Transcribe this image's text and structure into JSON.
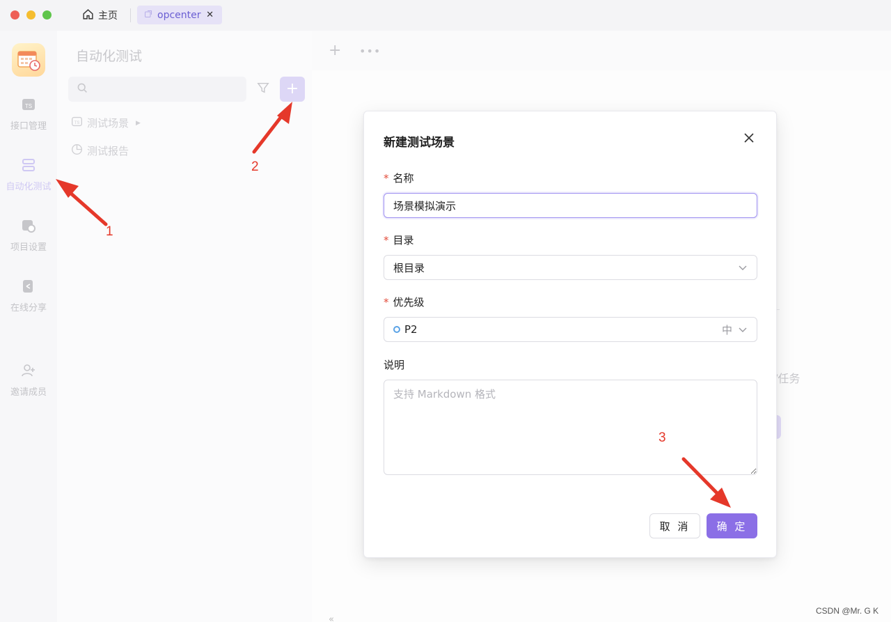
{
  "window": {
    "tabs": [
      {
        "label": "主页",
        "icon": "home-icon"
      },
      {
        "label": "opcenter",
        "icon": "external-link-icon",
        "active": true
      }
    ]
  },
  "leftnav": {
    "items": [
      {
        "label": "接口管理",
        "icon": "api-icon"
      },
      {
        "label": "自动化测试",
        "icon": "automation-icon",
        "active": true
      },
      {
        "label": "项目设置",
        "icon": "project-settings-icon"
      },
      {
        "label": "在线分享",
        "icon": "share-icon"
      },
      {
        "label": "邀请成员",
        "icon": "invite-member-icon"
      }
    ]
  },
  "sidepanel": {
    "title": "自动化测试",
    "search": {
      "placeholder": ""
    },
    "tree": [
      {
        "label": "测试场景",
        "icon": "scenario-icon"
      },
      {
        "label": "测试报告",
        "icon": "report-pie-icon"
      }
    ]
  },
  "background": {
    "partial_text": "/任务"
  },
  "modal": {
    "title": "新建测试场景",
    "fields": {
      "name": {
        "label": "名称",
        "required": true,
        "value": "场景模拟演示"
      },
      "directory": {
        "label": "目录",
        "required": true,
        "value": "根目录"
      },
      "priority": {
        "label": "优先级",
        "required": true,
        "value": "P2",
        "level": "中"
      },
      "description": {
        "label": "说明",
        "required": false,
        "placeholder": "支持 Markdown 格式"
      }
    },
    "buttons": {
      "cancel": "取 消",
      "confirm": "确 定"
    }
  },
  "annotations": {
    "step1": "1",
    "step2": "2",
    "step3": "3"
  },
  "watermark": "CSDN @Mr. G K",
  "colors": {
    "accent": "#8b6fe6",
    "annotation": "#e5382a",
    "required": "#e34d3c"
  }
}
